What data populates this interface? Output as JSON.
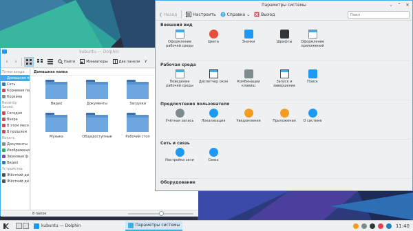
{
  "colors": {
    "accent": "#3daee9",
    "folder": "#5b95d1",
    "window_bg": "#eff0f1"
  },
  "dolphin": {
    "title": "kubuntu — Dolphin",
    "toolbar": {
      "split": "Найти",
      "preview": "Миниатюры",
      "panels": "Две панели",
      "more": "У"
    },
    "sidebar": {
      "groups": [
        {
          "label": "Точки входа",
          "items": [
            {
              "label": "Домашняя папка",
              "icon": "home-icon",
              "selected": true
            },
            {
              "label": "Сеть",
              "icon": "network-icon"
            },
            {
              "label": "Корневая па",
              "icon": "root-folder-icon"
            },
            {
              "label": "Корзина",
              "icon": "trash-icon"
            }
          ]
        },
        {
          "label": "Recently Saved",
          "items": [
            {
              "label": "Сегодня",
              "icon": "calendar-icon"
            },
            {
              "label": "Вчера",
              "icon": "calendar-icon"
            },
            {
              "label": "В этом меся",
              "icon": "calendar-icon"
            },
            {
              "label": "В прошлом",
              "icon": "calendar-icon"
            }
          ]
        },
        {
          "label": "Искать",
          "items": [
            {
              "label": "Документы",
              "icon": "document-icon"
            },
            {
              "label": "Изображени",
              "icon": "image-icon"
            },
            {
              "label": "Звуковые ф",
              "icon": "audio-icon"
            },
            {
              "label": "Видео",
              "icon": "video-icon"
            }
          ]
        },
        {
          "label": "Устройства",
          "items": [
            {
              "label": "Жёсткий ди",
              "icon": "drive-icon"
            },
            {
              "label": "Жёсткий ди",
              "icon": "drive-icon"
            }
          ]
        }
      ]
    },
    "breadcrumb": "Домашняя папка",
    "folders": [
      {
        "label": "Видео"
      },
      {
        "label": "Документы"
      },
      {
        "label": "Загрузки"
      },
      {
        "label": "Музыка"
      },
      {
        "label": "Общедоступные"
      },
      {
        "label": "Рабочий стол"
      }
    ],
    "status": "8 папок"
  },
  "settings": {
    "title": "Параметры системы",
    "toolbar": {
      "back": "Назад",
      "configure": "Настроить",
      "help": "Справка",
      "quit": "Выход",
      "search_placeholder": "Поиск"
    },
    "sections": [
      {
        "title": "Внешний вид",
        "modules": [
          {
            "label": "Оформление рабочей среды",
            "icon": "workspace-theme-icon",
            "color": "#7f8c8d"
          },
          {
            "label": "Цвета",
            "icon": "colors-icon",
            "color": "#e74c3c"
          },
          {
            "label": "Значки",
            "icon": "icons-icon",
            "color": "#1d99f3"
          },
          {
            "label": "Шрифты",
            "icon": "fonts-icon",
            "color": "#31363b"
          },
          {
            "label": "Оформление приложений",
            "icon": "app-style-icon",
            "color": "#7f8c8d"
          }
        ]
      },
      {
        "title": "Рабочая среда",
        "modules": [
          {
            "label": "Поведение рабочей среды",
            "icon": "workspace-behavior-icon",
            "color": "#7f8c8d"
          },
          {
            "label": "Диспетчер окон",
            "icon": "window-manager-icon",
            "color": "#31363b"
          },
          {
            "label": "Комбинации клавиш",
            "icon": "shortcuts-icon",
            "color": "#7f8c8d"
          },
          {
            "label": "Запуск и завершение",
            "icon": "startup-icon",
            "color": "#4d4d4d"
          },
          {
            "label": "Поиск",
            "icon": "search-settings-icon",
            "color": "#1d99f3"
          }
        ]
      },
      {
        "title": "Предпочтения пользователя",
        "modules": [
          {
            "label": "Учётная запись",
            "icon": "account-icon",
            "color": "#7f8c8d"
          },
          {
            "label": "Локализация",
            "icon": "locale-icon",
            "color": "#1d99f3"
          },
          {
            "label": "Уведомления",
            "icon": "notifications-icon",
            "color": "#f39c1f"
          },
          {
            "label": "Приложения",
            "icon": "applications-icon",
            "color": "#f39c1f"
          },
          {
            "label": "О системе",
            "icon": "about-icon",
            "color": "#1d99f3"
          }
        ]
      },
      {
        "title": "Сеть и связь",
        "modules": [
          {
            "label": "Настройка сети",
            "icon": "network-settings-icon",
            "color": "#1d99f3"
          },
          {
            "label": "Связь",
            "icon": "connectivity-icon",
            "color": "#1d99f3"
          }
        ]
      },
      {
        "title": "Оборудование",
        "modules": []
      }
    ]
  },
  "taskbar": {
    "tasks": [
      {
        "label": "kubuntu — Dolphin",
        "active": false
      },
      {
        "label": "Параметры системы",
        "active": true
      }
    ],
    "clock": "11:40"
  }
}
